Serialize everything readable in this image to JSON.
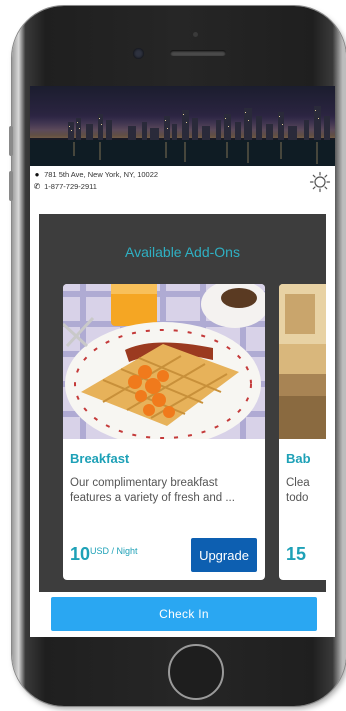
{
  "header": {
    "address": "781 5th Ave, New York, NY, 10022",
    "phone": "1-877-729-2911",
    "location_icon": "map-pin-icon",
    "phone_icon": "phone-icon",
    "theme_icon": "sun-icon"
  },
  "addons": {
    "title": "Available Add-Ons",
    "cards": [
      {
        "name": "Breakfast",
        "description": "Our complimentary breakfast features a variety of fresh and ...",
        "price": "10",
        "price_unit": "USD / Night",
        "button": "Upgrade"
      },
      {
        "name": "Bab",
        "description_line1": "Clea",
        "description_line2": "todo",
        "price": "15"
      }
    ]
  },
  "footer": {
    "checkin_label": "Check In"
  },
  "colors": {
    "accent": "#1ea1b7",
    "upgrade_button": "#0d5fb1",
    "checkin_button": "#2aa7f2",
    "panel": "#3d3d3d"
  }
}
